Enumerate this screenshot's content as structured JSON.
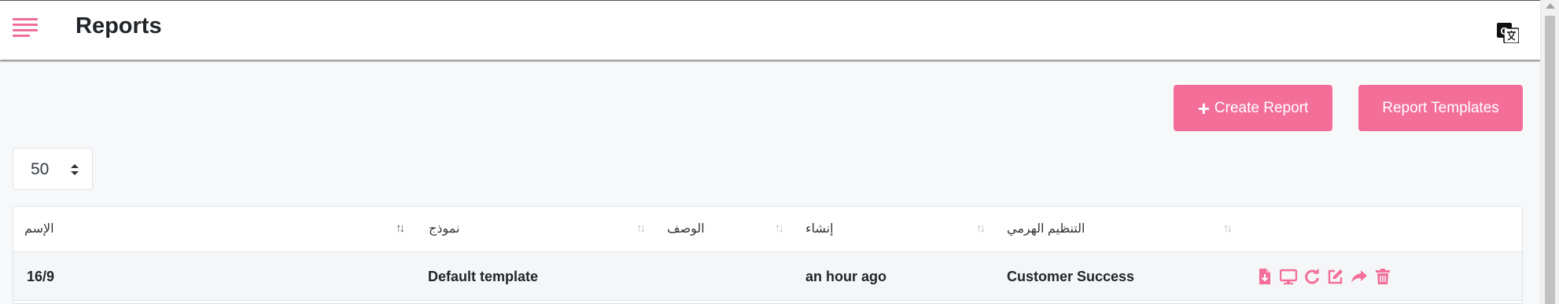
{
  "header": {
    "title": "Reports"
  },
  "toolbar": {
    "create_label": "Create Report",
    "templates_label": "Report Templates"
  },
  "page_size": {
    "value": "50"
  },
  "table": {
    "columns": [
      "الإسم",
      "نموذج",
      "الوصف",
      "إنشاء",
      "التنظيم الهرمي"
    ],
    "rows": [
      {
        "name": "16/9",
        "template": "Default template",
        "description": "",
        "created": "an hour ago",
        "hierarchy": "Customer Success"
      }
    ]
  },
  "colors": {
    "accent": "#f36f9a"
  },
  "icons": [
    "menu-icon",
    "translate-icon",
    "download-icon",
    "monitor-icon",
    "refresh-icon",
    "edit-icon",
    "share-icon",
    "trash-icon"
  ]
}
